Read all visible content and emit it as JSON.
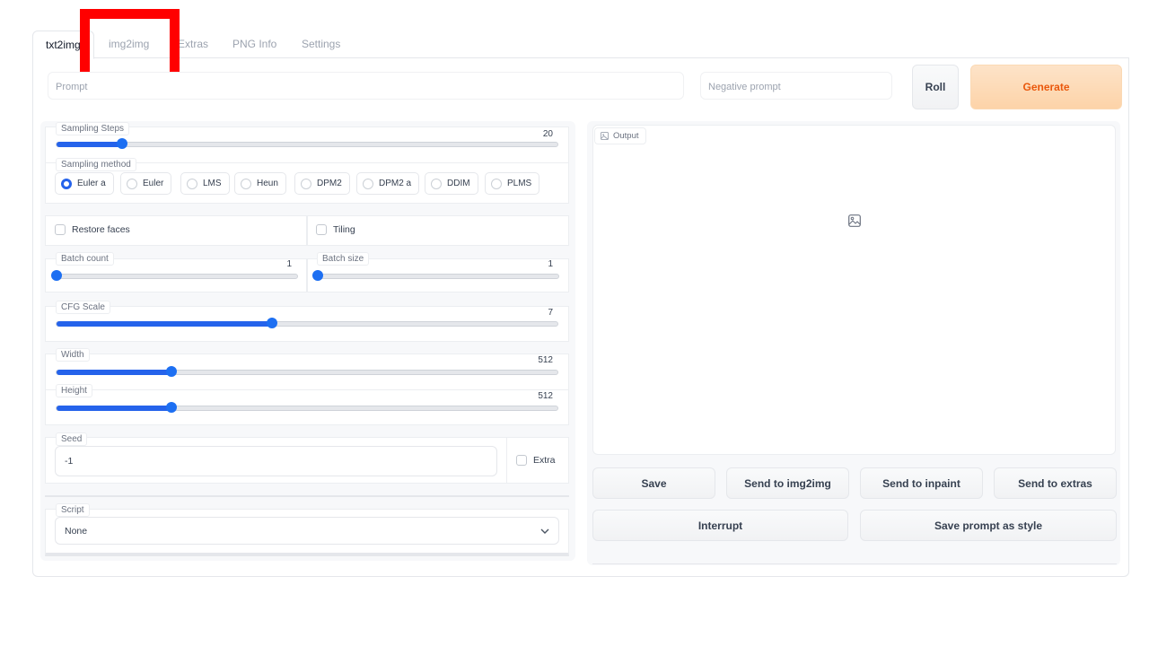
{
  "tabs": [
    "txt2img",
    "img2img",
    "Extras",
    "PNG Info",
    "Settings"
  ],
  "prompt": {
    "placeholder": "Prompt"
  },
  "negative_prompt": {
    "placeholder": "Negative prompt"
  },
  "buttons": {
    "roll": "Roll",
    "generate": "Generate"
  },
  "sampling_steps": {
    "label": "Sampling Steps",
    "value": "20",
    "fraction": 0.13
  },
  "sampling_method": {
    "label": "Sampling method",
    "options": [
      "Euler a",
      "Euler",
      "LMS",
      "Heun",
      "DPM2",
      "DPM2 a",
      "DDIM",
      "PLMS"
    ],
    "selected": "Euler a"
  },
  "restore_faces": "Restore faces",
  "tiling": "Tiling",
  "batch_count": {
    "label": "Batch count",
    "value": "1",
    "fraction": 0
  },
  "batch_size": {
    "label": "Batch size",
    "value": "1",
    "fraction": 0
  },
  "cfg_scale": {
    "label": "CFG Scale",
    "value": "7",
    "fraction": 0.43
  },
  "width": {
    "label": "Width",
    "value": "512",
    "fraction": 0.23
  },
  "height": {
    "label": "Height",
    "value": "512",
    "fraction": 0.23
  },
  "seed": {
    "label": "Seed",
    "value": "-1",
    "extra": "Extra"
  },
  "script": {
    "label": "Script",
    "value": "None"
  },
  "output": {
    "label": "Output"
  },
  "actions": {
    "save": "Save",
    "send_img2img": "Send to img2img",
    "send_inpaint": "Send to inpaint",
    "send_extras": "Send to extras",
    "interrupt": "Interrupt",
    "save_style": "Save prompt as style"
  },
  "colors": {
    "accent": "#2563eb",
    "generate_text": "#ea580c",
    "highlight_box": "#ff0000"
  },
  "annotation": {
    "highlighted_tab": "img2img"
  }
}
